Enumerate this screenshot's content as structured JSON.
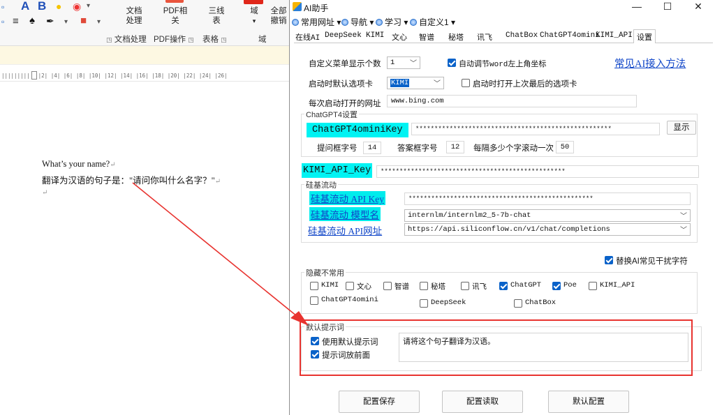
{
  "word": {
    "ribbon": {
      "doc_process": "文档处理",
      "pdf_related": "PDF相关",
      "three_line_table": "三线表",
      "field": "域",
      "undo_all": "全部撤销",
      "groups": [
        "文档处理",
        "PDF操作",
        "表格",
        "域"
      ]
    },
    "ruler_text": "|2| |4| |6| |8| |10| |12| |14| |16| |18| |20| |22| |24| |26|",
    "document": {
      "line1": "What’s your name?",
      "line2": "翻译为汉语的句子是：\"请问你叫什么名字？\"",
      "paragraph_mark": "↵"
    }
  },
  "dialog": {
    "title": "AI助手",
    "window_buttons": {
      "minimize": "—",
      "maximize": "☐",
      "close": "✕"
    },
    "menu": [
      "常用网址",
      "导航",
      "学习",
      "自定义1"
    ],
    "tabs": [
      "在线AI",
      "DeepSeek",
      "KIMI",
      "文心",
      "智谱",
      "秘塔",
      "讯飞",
      "ChatBox",
      "ChatGPT4omini",
      "KIMI_API",
      "设置"
    ],
    "active_tab": "设置",
    "settings": {
      "menu_count_label": "自定义菜单显示个数",
      "menu_count_value": "1",
      "auto_adjust_label": "自动调节word左上角坐标",
      "common_ai_link": "常见AI接入方法",
      "default_tab_label": "启动时默认选项卡",
      "default_tab_value": "KIMI",
      "open_last_tab_label": "启动时打开上次最后的选项卡",
      "startup_url_label": "每次启动打开的网址",
      "startup_url_value": "www.bing.com",
      "chatgpt_group": "ChatGPT4设置",
      "chatgpt_key_label": "ChatGPT4ominiKey",
      "chatgpt_key_value": "****************************************************",
      "show_button": "显示",
      "question_font_label": "提问框字号",
      "question_font_value": "14",
      "answer_font_label": "答案框字号",
      "answer_font_value": "12",
      "scroll_label": "每隔多少个字滚动一次",
      "scroll_value": "50",
      "kimi_key_label": "KIMI_API_Key",
      "kimi_key_value": "*************************************************",
      "silicon_group": "硅基流动",
      "silicon_key_label": "硅基流动 API Key",
      "silicon_key_value": "*************************************************",
      "silicon_model_label": "硅基流动 模型名",
      "silicon_model_value": "internlm/internlm2_5-7b-chat",
      "silicon_url_label": "硅基流动 API网址",
      "silicon_url_value": "https://api.siliconflow.cn/v1/chat/completions",
      "replace_chars_label": "替换AI常见干扰字符",
      "hidden_group": "隐藏不常用",
      "hidden_items": [
        {
          "label": "KIMI",
          "checked": false
        },
        {
          "label": "文心",
          "checked": false
        },
        {
          "label": "智谱",
          "checked": false
        },
        {
          "label": "秘塔",
          "checked": false
        },
        {
          "label": "讯飞",
          "checked": false
        },
        {
          "label": "ChatGPT",
          "checked": true
        },
        {
          "label": "Poe",
          "checked": true
        },
        {
          "label": "KIMI_API",
          "checked": false
        },
        {
          "label": "ChatGPT4omini",
          "checked": false
        },
        {
          "label": "DeepSeek",
          "checked": false
        },
        {
          "label": "ChatBox",
          "checked": false
        }
      ],
      "prompt_group": "默认提示词",
      "use_default_prompt_label": "使用默认提示词",
      "prompt_front_label": "提示词放前面",
      "prompt_text": "请将这个句子翻译为汉语。",
      "save_button": "配置保存",
      "load_button": "配置读取",
      "default_button": "默认配置"
    }
  },
  "colors": {
    "highlight": "#00f3f3",
    "annotation": "#e8332f",
    "check": "#0a62c9",
    "link": "#1046c8"
  }
}
